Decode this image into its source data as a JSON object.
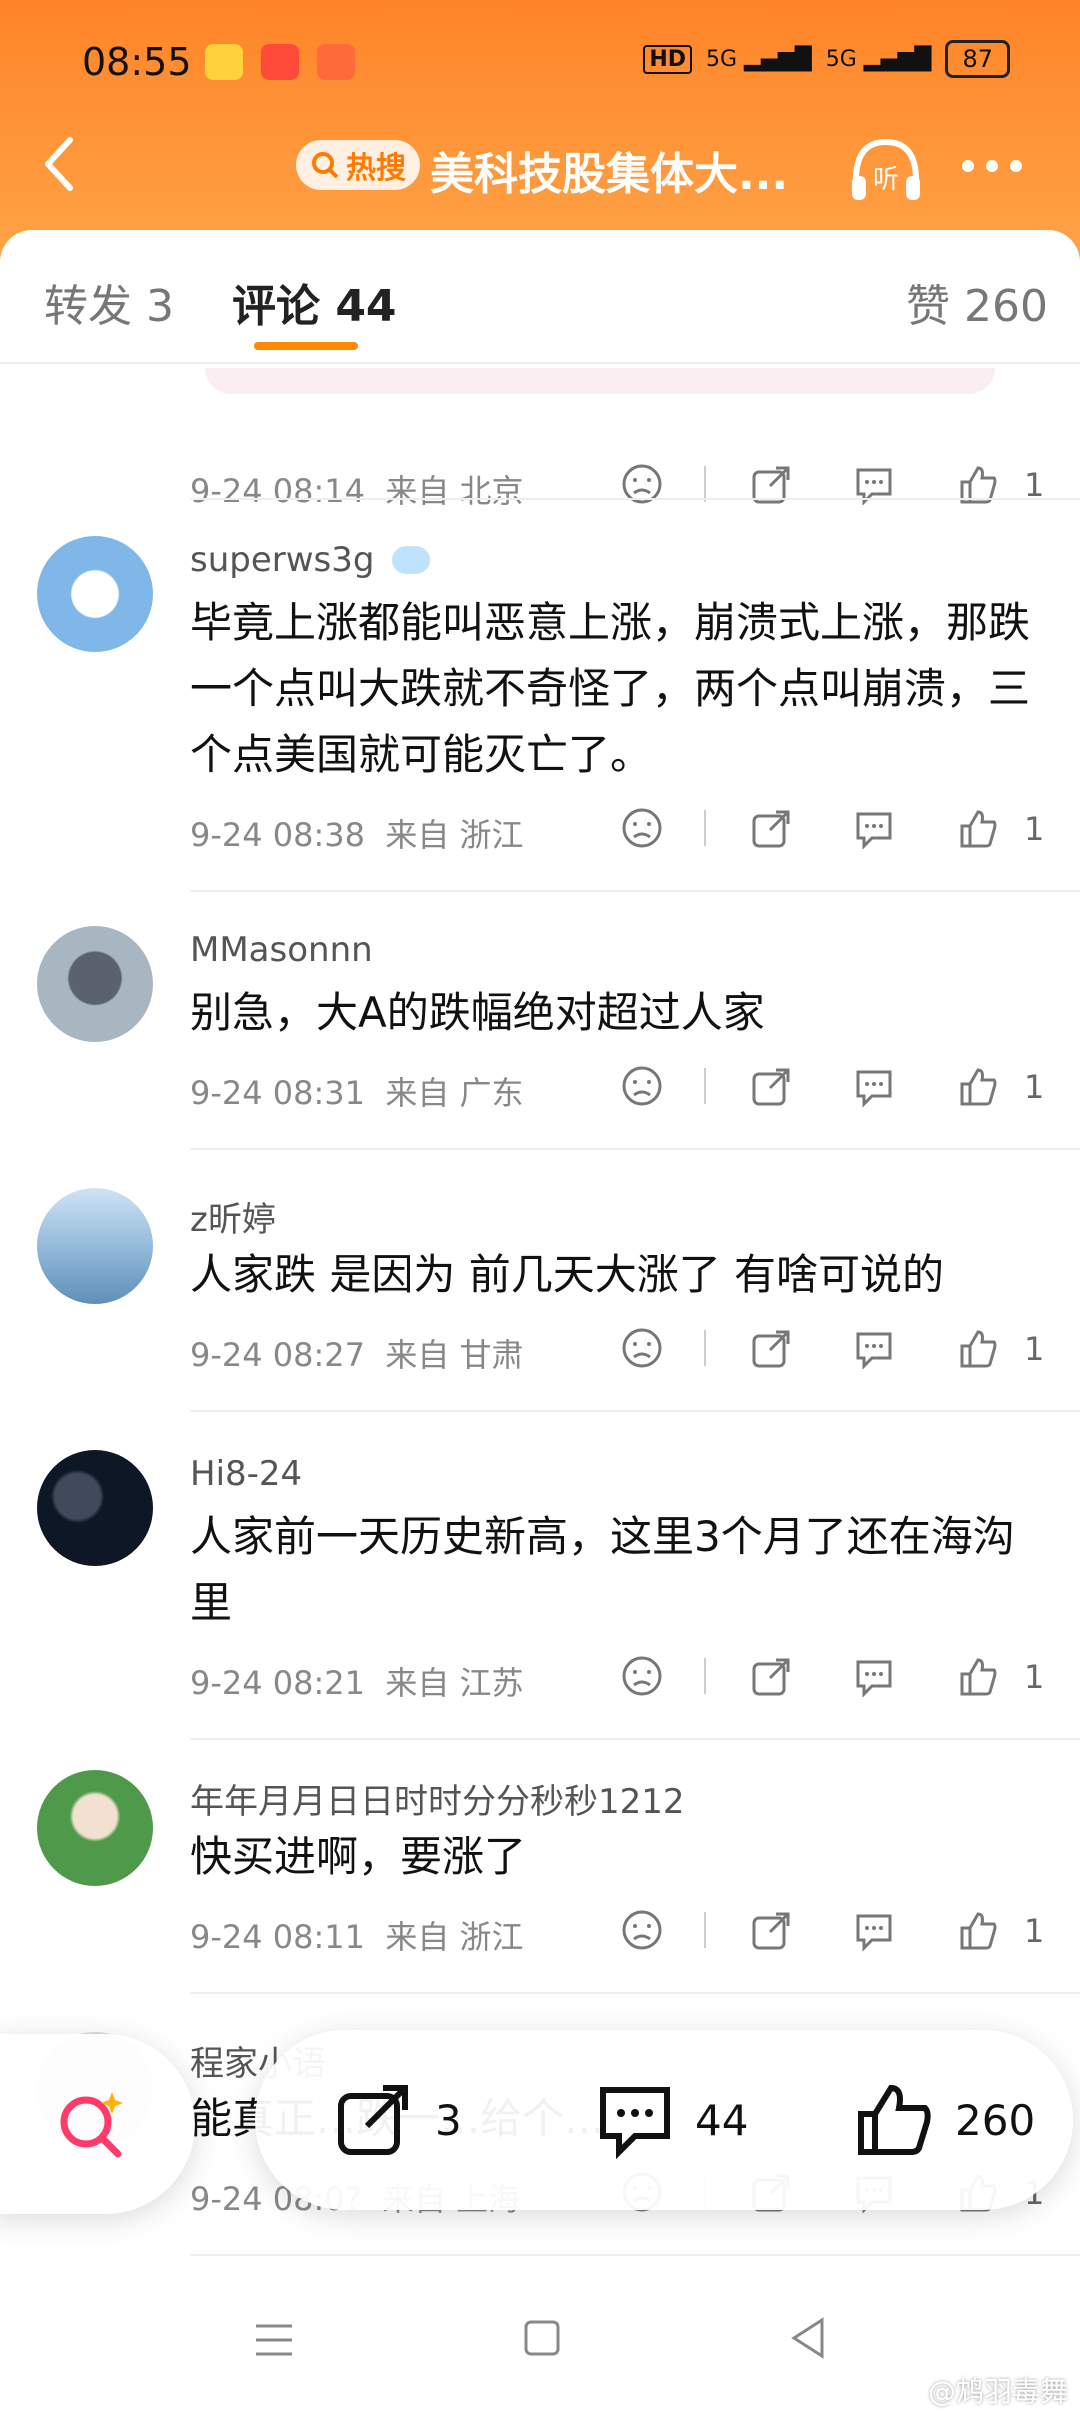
{
  "status_bar": {
    "time": "08:55",
    "battery": "87",
    "net1": "HD",
    "net2": "5G",
    "net3": "5G"
  },
  "nav": {
    "hot_tag": "热搜",
    "title": "美科技股集体大...",
    "listen": "听"
  },
  "tabs": {
    "repost": "转发 3",
    "comments": "评论 44",
    "likes": "赞 260"
  },
  "top_meta": {
    "time": "9-24 08:14",
    "location": "来自 北京",
    "likes": "1"
  },
  "comments": [
    {
      "user": "superws3g",
      "text": "毕竟上涨都能叫恶意上涨，崩溃式上涨，那跌一个点叫大跌就不奇怪了，两个点叫崩溃，三个点美国就可能灭亡了。",
      "time": "9-24 08:38",
      "location": "来自 浙江",
      "likes": "1"
    },
    {
      "user": "MMasonnn",
      "text": "别急，大A的跌幅绝对超过人家",
      "time": "9-24 08:31",
      "location": "来自 广东",
      "likes": "1"
    },
    {
      "user": "z昕婷",
      "text": "人家跌 是因为 前几天大涨了 有啥可说的",
      "time": "9-24 08:27",
      "location": "来自 甘肃",
      "likes": "1"
    },
    {
      "user": "Hi8-24",
      "text": "人家前一天历史新高，这里3个月了还在海沟里",
      "time": "9-24 08:21",
      "location": "来自 江苏",
      "likes": "1"
    },
    {
      "user": "年年月月日日时时分分秒秒1212",
      "text": "快买进啊，要涨了",
      "time": "9-24 08:11",
      "location": "来自 浙江",
      "likes": "1"
    },
    {
      "user": "程家小语",
      "text": "能真正...跌一...给个...",
      "time": "9-24 08:0?",
      "location": "来自 上海",
      "likes": "1"
    }
  ],
  "bottom_bar": {
    "reposts": "3",
    "comments": "44",
    "likes": "260"
  },
  "watermark": "@鸩羽毒舞",
  "colors": {
    "accent": "#ff8a00",
    "header": "#ff8428"
  }
}
